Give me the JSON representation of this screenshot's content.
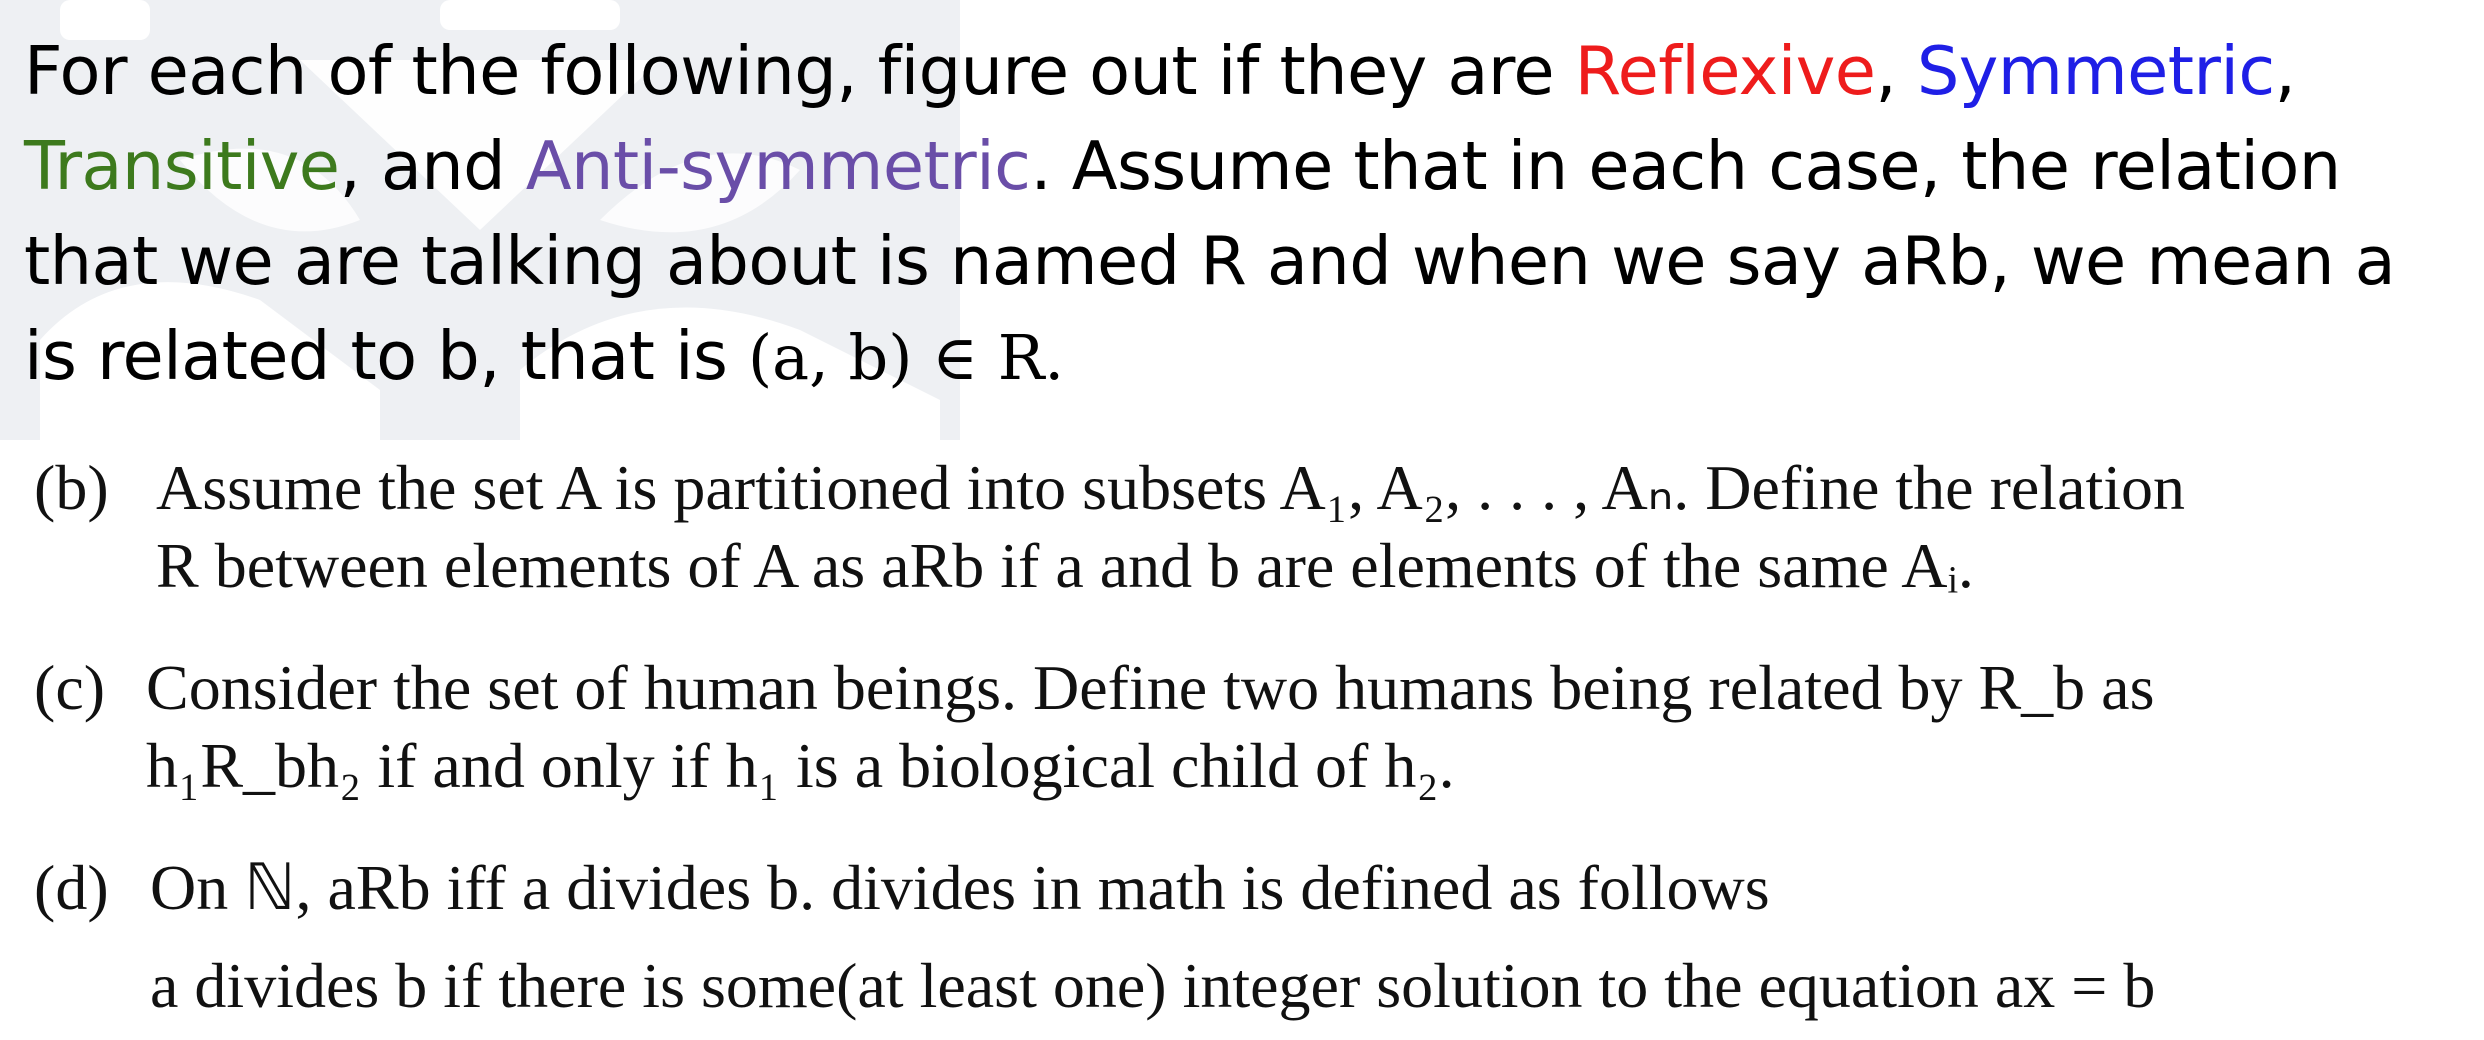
{
  "intro": {
    "part1": "For each of the following, figure out if they are ",
    "reflexive": "Reflexive",
    "sep1": ", ",
    "symmetric": "Symmetric",
    "sep2": ",",
    "transitive": "Transitive",
    "sep3": ", and ",
    "antisymmetric": "Anti-symmetric",
    "part2": ". Assume that in each case, the relation that we are talking about is named R and when we say aRb, we mean a is related to b, that is ",
    "math": "(a, b) ∈ R."
  },
  "colors": {
    "reflexive": "#ee1c1c",
    "symmetric": "#1f1fe6",
    "transitive": "#3d7a1d",
    "antisymmetric": "#6a4ea8"
  },
  "problems": {
    "b": {
      "label": "(b)",
      "line1": "Assume the set A is partitioned into subsets A₁, A₂, . . . , Aₙ. Define the relation",
      "line2": "R between elements of A as aRb if a and b are elements of the same Aᵢ."
    },
    "c": {
      "label": "(c)",
      "line1": "Consider the set of human beings. Define two humans being related by R_b as",
      "line2": "h₁R_bh₂ if and only if h₁ is a biological child of h₂."
    },
    "d": {
      "label": "(d)",
      "line1": "On ℕ, aRb iff a divides b. divides in math is defined as follows",
      "line2": "a divides b if there is some(at least one) integer solution to the equation ax = b"
    }
  }
}
